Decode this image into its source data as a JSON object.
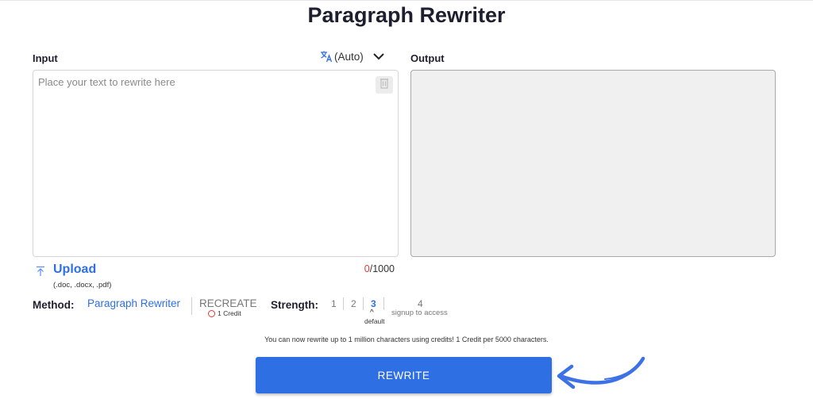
{
  "page": {
    "title": "Paragraph Rewriter"
  },
  "input": {
    "label": "Input",
    "placeholder": "Place your text to rewrite here",
    "value": "",
    "language": "(Auto)"
  },
  "output": {
    "label": "Output"
  },
  "upload": {
    "label": "Upload",
    "types": "(.doc, .docx, .pdf)"
  },
  "counter": {
    "current": "0",
    "max": "/1000"
  },
  "method": {
    "label": "Method:",
    "options": [
      {
        "label": "Paragraph Rewriter",
        "selected": true
      },
      {
        "label": "RECREATE",
        "credit": "1 Credit"
      }
    ]
  },
  "strength": {
    "label": "Strength:",
    "levels": [
      "1",
      "2",
      "3",
      "4"
    ],
    "selected": "3",
    "default_label": "default",
    "locked_note": "signup to access"
  },
  "notice": "You can now rewrite up to 1 million characters using credits! 1 Credit per 5000 characters.",
  "action": {
    "label": "REWRITE"
  },
  "colors": {
    "accent": "#2f6fe4",
    "counter_current": "#e53935",
    "output_bg": "#f0f0f0"
  }
}
